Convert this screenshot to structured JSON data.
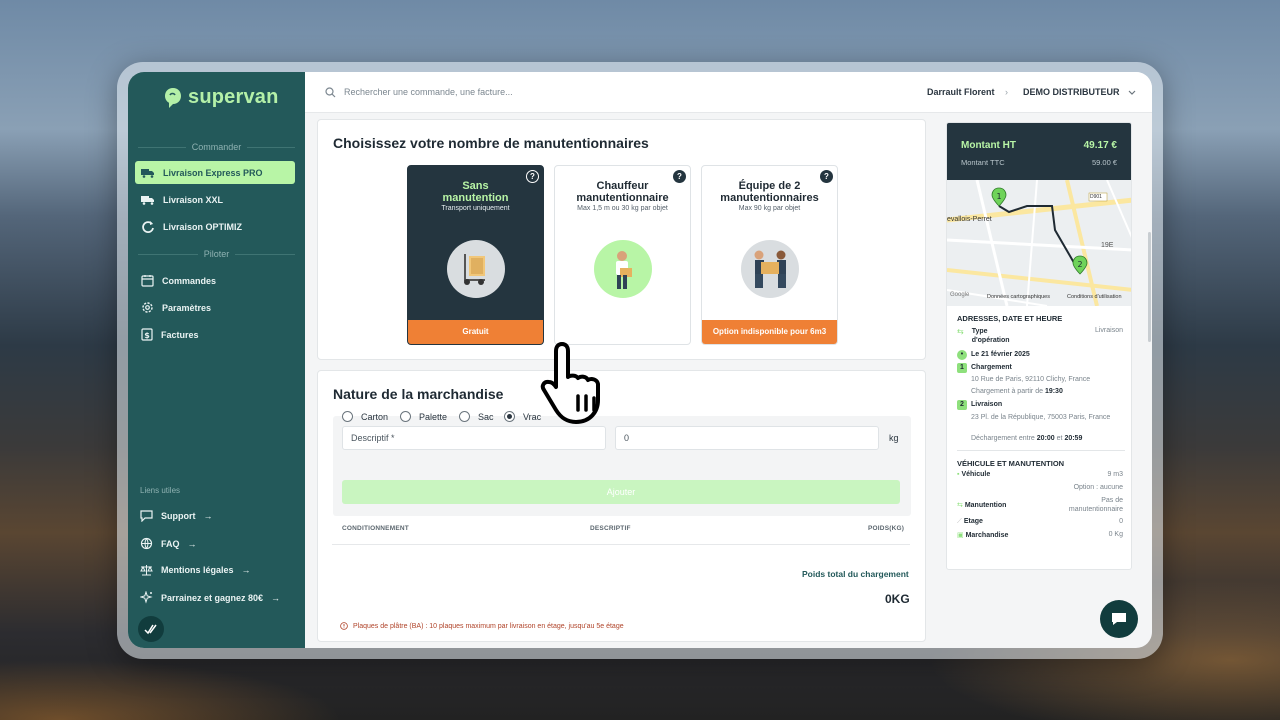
{
  "app": {
    "logo": "supervan"
  },
  "sidebar": {
    "section_order": "Commander",
    "section_pilot": "Piloter",
    "order_items": [
      {
        "label": "Livraison Express PRO",
        "icon": "truck-icon",
        "active": true
      },
      {
        "label": "Livraison XXL",
        "icon": "truck-icon"
      },
      {
        "label": "Livraison OPTIMIZ",
        "icon": "refresh-icon"
      }
    ],
    "pilot_items": [
      {
        "label": "Commandes",
        "icon": "calendar-icon"
      },
      {
        "label": "Paramètres",
        "icon": "gear-icon"
      },
      {
        "label": "Factures",
        "icon": "invoice-icon"
      }
    ],
    "links_title": "Liens utiles",
    "links": [
      {
        "label": "Support",
        "icon": "chat-icon"
      },
      {
        "label": "FAQ",
        "icon": "globe-icon"
      },
      {
        "label": "Mentions légales",
        "icon": "scale-icon"
      },
      {
        "label": "Parrainez et gagnez 80€",
        "icon": "sparkle-icon"
      }
    ]
  },
  "topbar": {
    "search_placeholder": "Rechercher une commande, une facture...",
    "user": "Darrault Florent",
    "company": "DEMO DISTRIBUTEUR"
  },
  "handling": {
    "title": "Choisissez votre nombre de manutentionnaires",
    "options": [
      {
        "title": "Sans manutention",
        "subtitle": "Transport uniquement",
        "footer": "Gratuit",
        "selected": true
      },
      {
        "title": "Chauffeur manutentionnaire",
        "subtitle": "Max 1,5 m ou 30 kg par objet",
        "footer": ""
      },
      {
        "title": "Équipe de 2 manutentionnaires",
        "subtitle": "Max 90 kg par objet",
        "footer": "Option indisponible pour 6m3"
      }
    ]
  },
  "goods": {
    "title": "Nature de la marchandise",
    "descriptif_placeholder": "Descriptif *",
    "weight_value": "0",
    "weight_unit": "kg",
    "packaging": [
      {
        "label": "Carton",
        "checked": false
      },
      {
        "label": "Palette",
        "checked": false
      },
      {
        "label": "Sac",
        "checked": false
      },
      {
        "label": "Vrac",
        "checked": true
      }
    ],
    "add_label": "Ajouter",
    "columns": [
      "CONDITIONNEMENT",
      "DESCRIPTIF",
      "POIDS(KG)"
    ],
    "total_label": "Poids total du chargement",
    "total_value": "0KG",
    "warning": "Plaques de plâtre (BA) : 10 plaques maximum par livraison en étage, jusqu'au 5e étage"
  },
  "summary": {
    "amount_ht_label": "Montant HT",
    "amount_ht": "49.17 €",
    "amount_ttc_label": "Montant TTC",
    "amount_ttc": "59.00 €",
    "map_labels": {
      "city": "evallois-Perret",
      "road": "D901",
      "district": "19E",
      "footer_data": "Données cartographiques",
      "footer_terms": "Conditions d'utilisation",
      "google": "Google"
    },
    "addresses_title": "ADRESSES, DATE ET HEURE",
    "operation_type_label": "Type d'opération",
    "operation_type": "Livraison",
    "date": "Le 21 février 2025",
    "loading_label": "Chargement",
    "loading_address": "10 Rue de Paris, 92110 Clichy, France",
    "loading_time_prefix": "Chargement à partir de",
    "loading_time": "19:30",
    "delivery_label": "Livraison",
    "delivery_address": "23 Pl. de la République, 75003 Paris, France",
    "unloading_prefix": "Déchargement entre",
    "unloading_from": "20:00",
    "unloading_and": "et",
    "unloading_to": "20:59",
    "vehicle_title": "VÉHICULE ET MANUTENTION",
    "vehicle_label": "Véhicule",
    "vehicle_value": "9 m3",
    "vehicle_option": "Option : aucune",
    "handling_label": "Manutention",
    "handling_value": "Pas de manutentionnaire",
    "floor_label": "Etage",
    "floor_value": "0",
    "goods_label": "Marchandise",
    "goods_value": "0 Kg"
  },
  "colors": {
    "sidebar": "#23595a",
    "accent_green": "#b8f5a6",
    "orange": "#ef8035",
    "dark": "#24353f"
  }
}
